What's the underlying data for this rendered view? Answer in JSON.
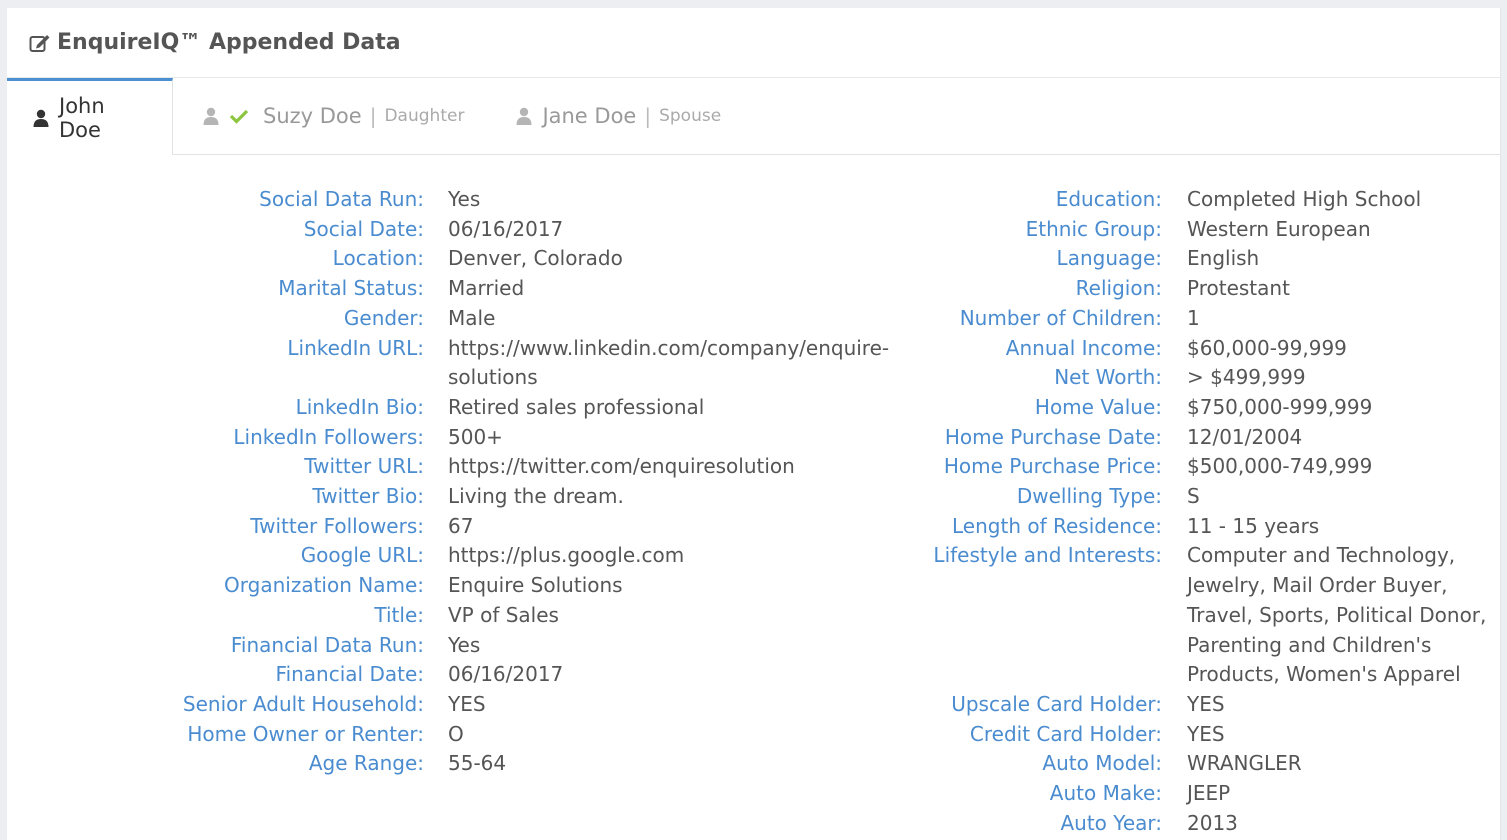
{
  "panel": {
    "title": "EnquireIQ™ Appended Data",
    "title_icon": "edit-icon"
  },
  "tabs": [
    {
      "name": "John Doe",
      "relation": "",
      "active": true,
      "icon": "user-icon"
    },
    {
      "name": "Suzy Doe",
      "relation": "Daughter",
      "active": false,
      "checked": true,
      "icon": "user-icon"
    },
    {
      "name": "Jane Doe",
      "relation": "Spouse",
      "active": false,
      "icon": "user-icon"
    }
  ],
  "colors": {
    "accent": "#4a90d2",
    "label": "#4a8ccf",
    "check": "#8cc63f"
  },
  "left": [
    {
      "label": "Social Data Run:",
      "value": "Yes"
    },
    {
      "label": "Social Date:",
      "value": "06/16/2017"
    },
    {
      "label": "Location:",
      "value": "Denver, Colorado"
    },
    {
      "label": "Marital Status:",
      "value": "Married"
    },
    {
      "label": "Gender:",
      "value": "Male"
    },
    {
      "label": "LinkedIn URL:",
      "value": "https://www.linkedin.com/company/enquire-solutions"
    },
    {
      "label": "LinkedIn Bio:",
      "value": "Retired sales professional"
    },
    {
      "label": "LinkedIn Followers:",
      "value": "500+"
    },
    {
      "label": "Twitter URL:",
      "value": "https://twitter.com/enquiresolution"
    },
    {
      "label": "Twitter Bio:",
      "value": "Living the dream."
    },
    {
      "label": "Twitter Followers:",
      "value": "67"
    },
    {
      "label": "Google URL:",
      "value": "https://plus.google.com"
    },
    {
      "label": "Organization Name:",
      "value": "Enquire Solutions"
    },
    {
      "label": "Title:",
      "value": "VP of Sales"
    },
    {
      "label": "Financial Data Run:",
      "value": "Yes"
    },
    {
      "label": "Financial Date:",
      "value": "06/16/2017"
    },
    {
      "label": "Senior Adult Household:",
      "value": "YES"
    },
    {
      "label": "Home Owner or Renter:",
      "value": "O"
    },
    {
      "label": "Age Range:",
      "value": "55-64"
    }
  ],
  "right": [
    {
      "label": "Education:",
      "value": "Completed High School"
    },
    {
      "label": "Ethnic Group:",
      "value": "Western European"
    },
    {
      "label": "Language:",
      "value": "English"
    },
    {
      "label": "Religion:",
      "value": "Protestant"
    },
    {
      "label": "Number of Children:",
      "value": "1"
    },
    {
      "label": "Annual Income:",
      "value": "$60,000-99,999"
    },
    {
      "label": "Net Worth:",
      "value": "> $499,999"
    },
    {
      "label": "Home Value:",
      "value": "$750,000-999,999"
    },
    {
      "label": "Home Purchase Date:",
      "value": "12/01/2004"
    },
    {
      "label": "Home Purchase Price:",
      "value": "$500,000-749,999"
    },
    {
      "label": "Dwelling Type:",
      "value": "S"
    },
    {
      "label": "Length of Residence:",
      "value": "11 - 15 years"
    },
    {
      "label": "Lifestyle and Interests:",
      "value": "Computer and Technology, Jewelry, Mail Order Buyer, Travel, Sports, Political Donor, Parenting and Children's Products, Women's Apparel"
    },
    {
      "label": "Upscale Card Holder:",
      "value": "YES"
    },
    {
      "label": "Credit Card Holder:",
      "value": "YES"
    },
    {
      "label": "Auto Model:",
      "value": "WRANGLER"
    },
    {
      "label": "Auto Make:",
      "value": "JEEP"
    },
    {
      "label": "Auto Year:",
      "value": "2013"
    }
  ]
}
